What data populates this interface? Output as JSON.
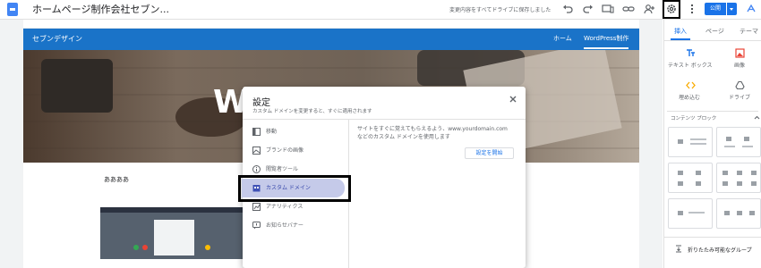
{
  "topbar": {
    "site_title": "ホームページ制作会社セブン...",
    "save_status": "変更内容をすべてドライブに保存しました",
    "publish_label": "公開",
    "icons": [
      "undo-icon",
      "redo-icon",
      "preview-icon",
      "link-icon",
      "share-icon",
      "settings-icon",
      "more-icon",
      "publish-dropdown-icon",
      "assistant-icon"
    ]
  },
  "site": {
    "name": "セブンデザイン",
    "nav": [
      "ホーム",
      "WordPress制作"
    ],
    "hero_text": "W",
    "section_label": "ああああ"
  },
  "dialog": {
    "title": "設定",
    "subtitle": "カスタム ドメインを変更すると、すぐに適用されます",
    "menu": [
      {
        "label": "移動",
        "icon": "navigation-icon"
      },
      {
        "label": "ブランドの画像",
        "icon": "brand-images-icon"
      },
      {
        "label": "閲覧者ツール",
        "icon": "viewer-tools-icon"
      },
      {
        "label": "カスタム ドメイン",
        "icon": "custom-domain-icon",
        "active": true
      },
      {
        "label": "アナリティクス",
        "icon": "analytics-icon"
      },
      {
        "label": "お知らせバナー",
        "icon": "announcement-banner-icon"
      }
    ],
    "description_line1": "サイトをすぐに覚えてもらえるよう、www.yourdomain.com",
    "description_line2": "などのカスタム ドメインを使用します",
    "start_button": "設定を開始"
  },
  "panel": {
    "tabs": [
      "挿入",
      "ページ",
      "テーマ"
    ],
    "insert_items": [
      {
        "label": "テキスト ボックス",
        "icon": "text-box-icon"
      },
      {
        "label": "画像",
        "icon": "image-icon"
      },
      {
        "label": "埋め込む",
        "icon": "embed-icon"
      },
      {
        "label": "ドライブ",
        "icon": "drive-icon"
      }
    ],
    "blocks_label": "コンテンツ ブロック",
    "collapsible_label": "折りたたみ可能なグループ"
  },
  "colors": {
    "accent": "#1a73e8",
    "site_header": "#1a73c8",
    "active_menu": "#c5cae9"
  }
}
